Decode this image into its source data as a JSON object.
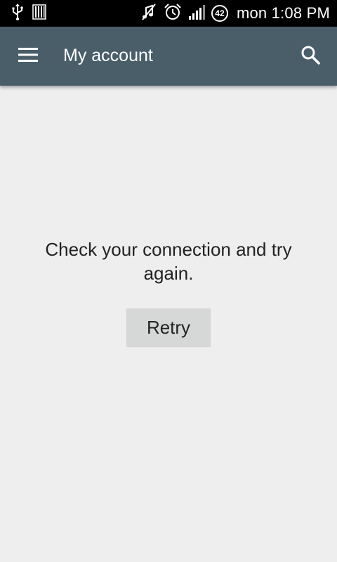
{
  "status_bar": {
    "time": "mon 1:08 PM",
    "battery_level": "42",
    "icons": [
      "usb-icon",
      "storage-icon",
      "mute-icon",
      "alarm-icon",
      "signal-icon",
      "battery-icon"
    ]
  },
  "app_bar": {
    "title": "My account",
    "menu_icon": "hamburger-menu-icon",
    "search_icon": "search-icon",
    "background": "#4a5e6a"
  },
  "content": {
    "message": "Check your connection and try again.",
    "retry_label": "Retry"
  }
}
